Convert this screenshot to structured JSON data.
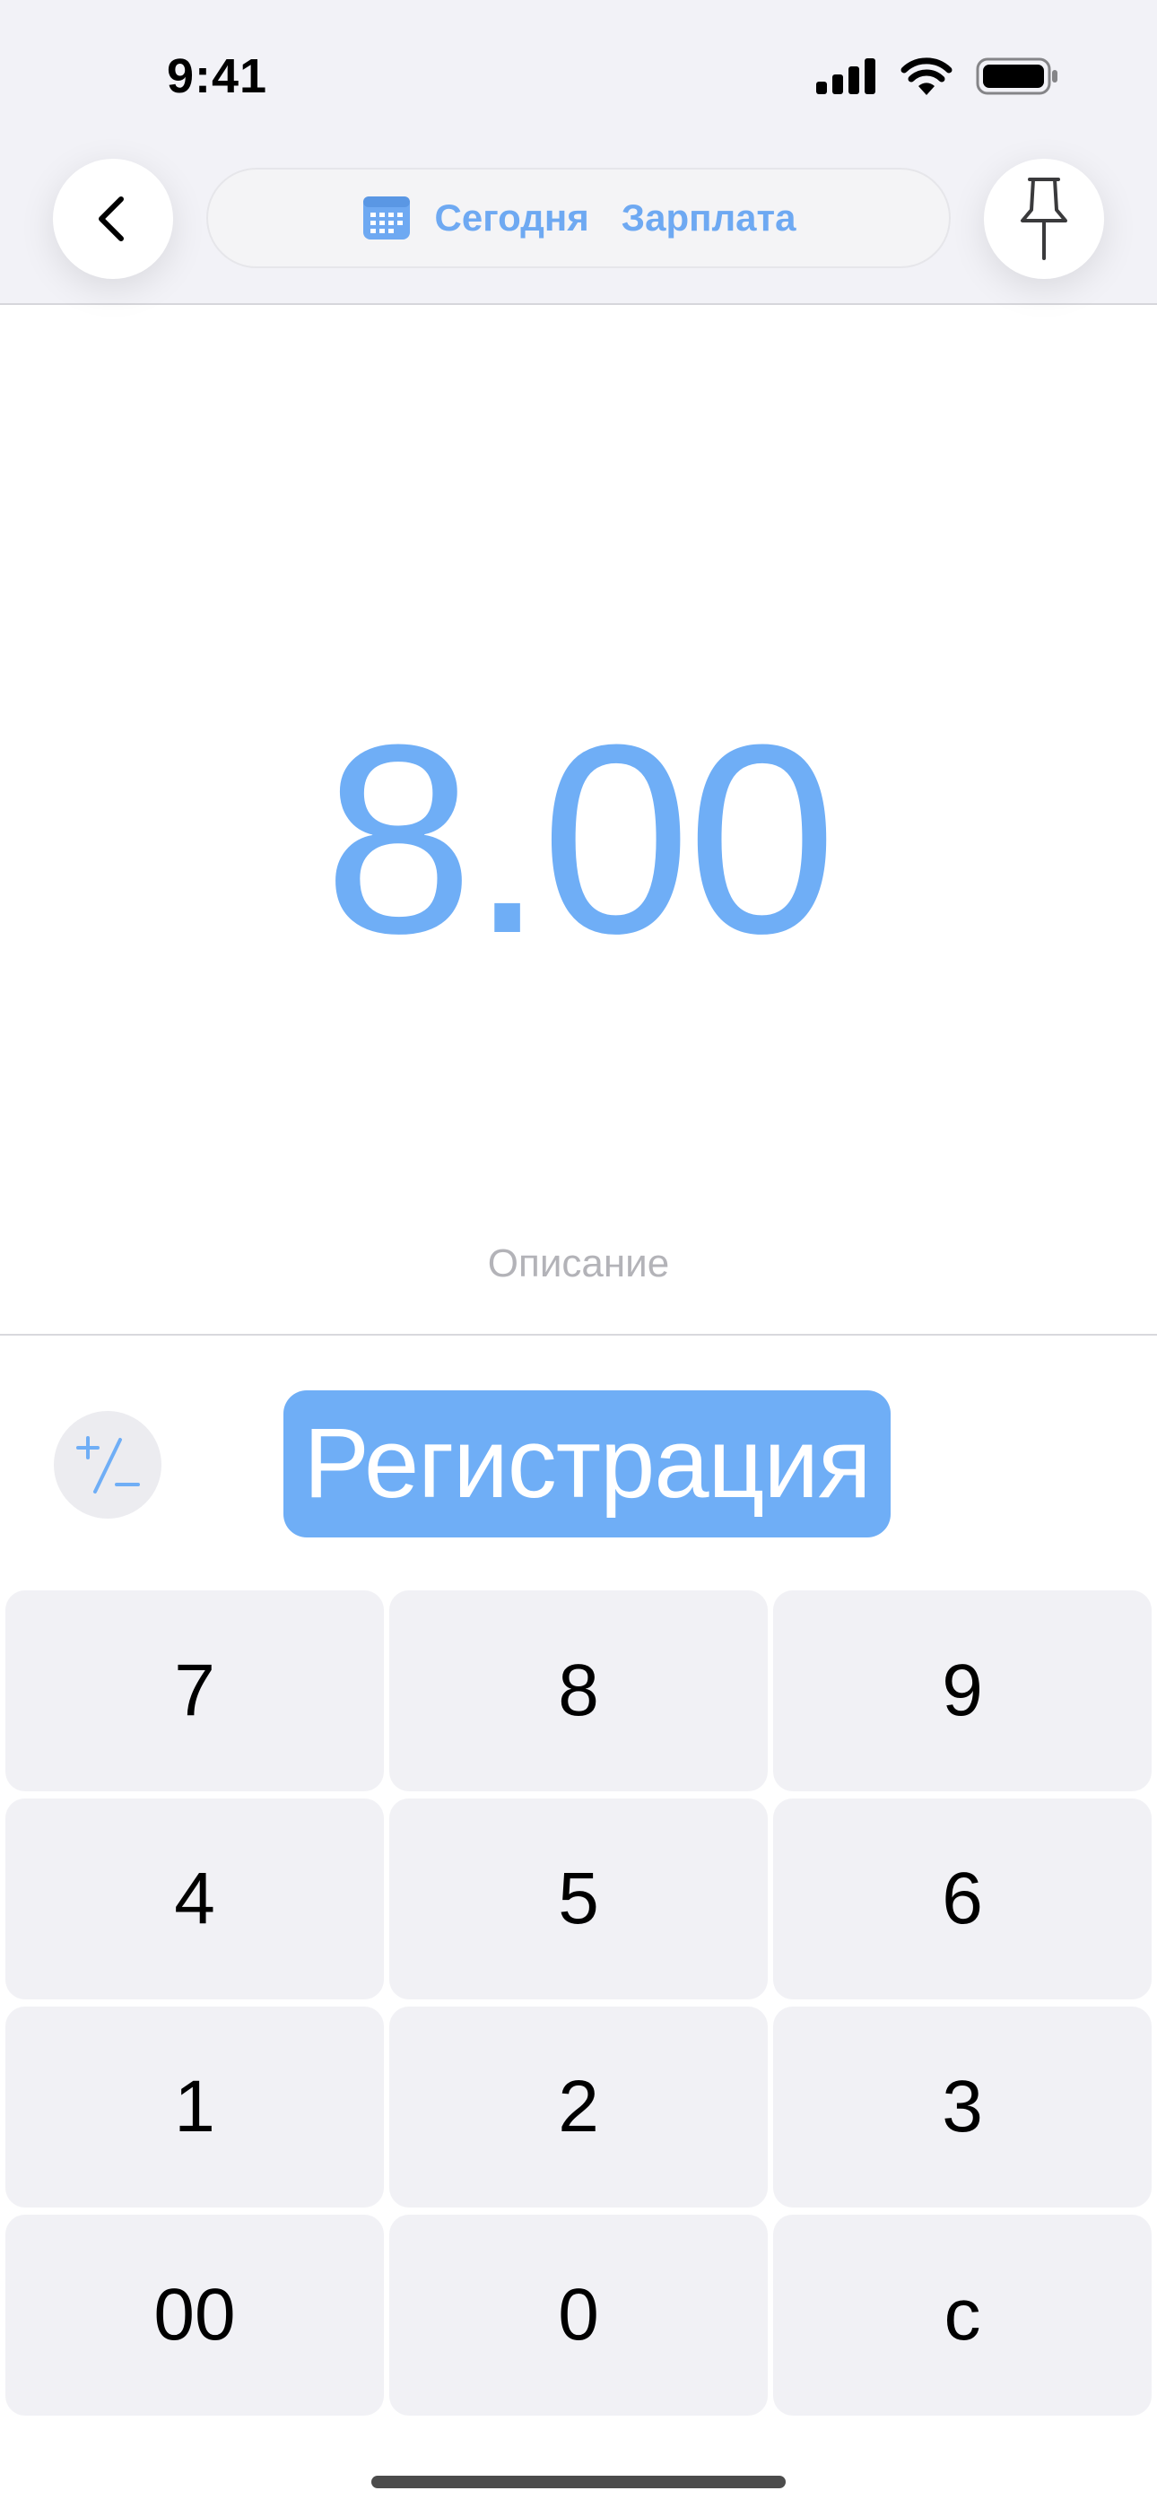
{
  "status_bar": {
    "time": "9:41",
    "icons": [
      "cellular-signal-icon",
      "wifi-icon",
      "battery-icon"
    ]
  },
  "header": {
    "back_icon": "chevron-left-icon",
    "date_icon": "calendar-icon",
    "date_label": "Сегодня",
    "category_label": "Зарплата",
    "pin_icon": "pushpin-icon"
  },
  "amount": {
    "value": "8.00"
  },
  "description": {
    "placeholder": "Описание"
  },
  "actions": {
    "sign_toggle_icon": "plus-minus-icon",
    "sign_toggle_label": "+/−",
    "submit_label": "Регистрация"
  },
  "keypad": {
    "keys": [
      "7",
      "8",
      "9",
      "4",
      "5",
      "6",
      "1",
      "2",
      "3",
      "00",
      "0",
      "c"
    ]
  },
  "colors": {
    "accent": "#6faef6",
    "header_bg": "#f2f2f7",
    "key_bg": "#f1f1f5",
    "placeholder": "#b3b3b8"
  }
}
